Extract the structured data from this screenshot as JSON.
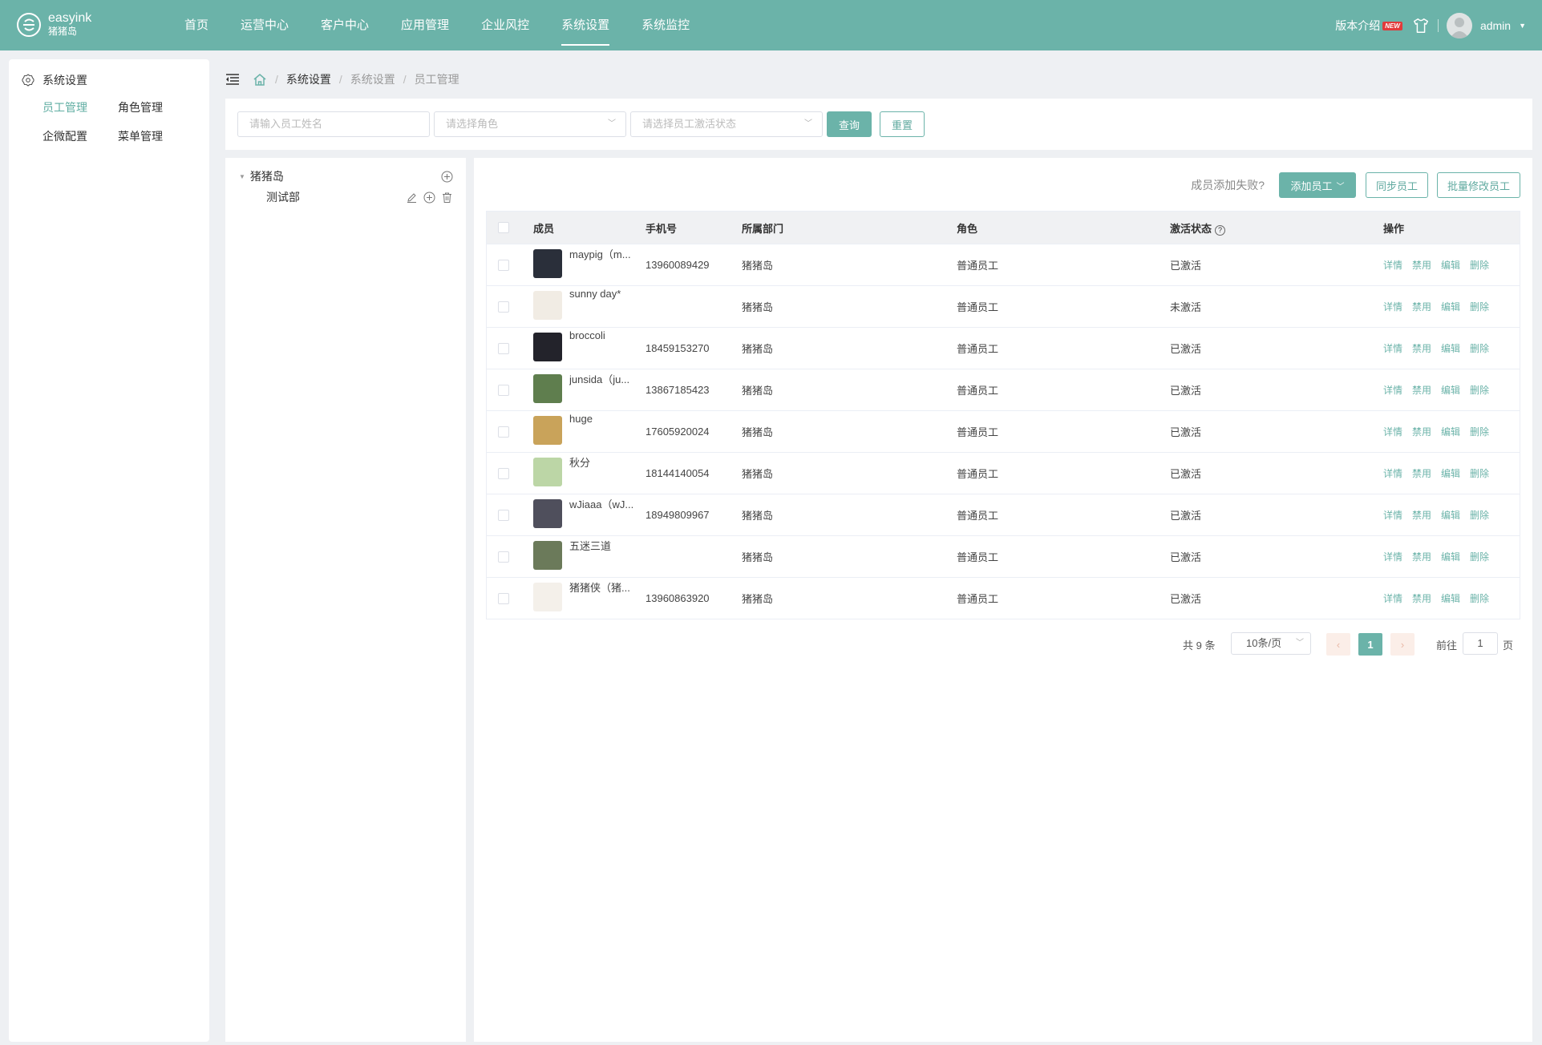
{
  "app": {
    "logo_name": "easyink",
    "logo_sub": "猪猪岛"
  },
  "nav": [
    {
      "label": "首页",
      "active": false
    },
    {
      "label": "运营中心",
      "active": false
    },
    {
      "label": "客户中心",
      "active": false
    },
    {
      "label": "应用管理",
      "active": false
    },
    {
      "label": "企业风控",
      "active": false
    },
    {
      "label": "系统设置",
      "active": true
    },
    {
      "label": "系统监控",
      "active": false
    }
  ],
  "topright": {
    "version_label": "版本介绍",
    "new_badge": "NEW",
    "user": "admin"
  },
  "sidebar": {
    "title": "系统设置",
    "links": [
      {
        "label": "员工管理",
        "active": true
      },
      {
        "label": "角色管理",
        "active": false
      },
      {
        "label": "企微配置",
        "active": false
      },
      {
        "label": "菜单管理",
        "active": false
      }
    ]
  },
  "breadcrumb": [
    "系统设置",
    "系统设置",
    "员工管理"
  ],
  "filters": {
    "name_placeholder": "请输入员工姓名",
    "role_placeholder": "请选择角色",
    "status_placeholder": "请选择员工激活状态",
    "query": "查询",
    "reset": "重置"
  },
  "tree": {
    "root": "猪猪岛",
    "children": [
      "测试部"
    ]
  },
  "toolbar": {
    "fail_text": "成员添加失败?",
    "add": "添加员工",
    "sync": "同步员工",
    "batch": "批量修改员工"
  },
  "table": {
    "headers": [
      "成员",
      "手机号",
      "所属部门",
      "角色",
      "激活状态",
      "操作"
    ],
    "status_help": "?",
    "ops": [
      "详情",
      "禁用",
      "编辑",
      "删除"
    ],
    "rows": [
      {
        "name": "maypig（m...",
        "phone": "13960089429",
        "dept": "猪猪岛",
        "role": "普通员工",
        "status": "已激活"
      },
      {
        "name": "sunny day*",
        "phone": "",
        "dept": "猪猪岛",
        "role": "普通员工",
        "status": "未激活"
      },
      {
        "name": "broccoli",
        "phone": "18459153270",
        "dept": "猪猪岛",
        "role": "普通员工",
        "status": "已激活"
      },
      {
        "name": "junsida（ju...",
        "phone": "13867185423",
        "dept": "猪猪岛",
        "role": "普通员工",
        "status": "已激活"
      },
      {
        "name": "huge",
        "phone": "17605920024",
        "dept": "猪猪岛",
        "role": "普通员工",
        "status": "已激活"
      },
      {
        "name": "秋分",
        "phone": "18144140054",
        "dept": "猪猪岛",
        "role": "普通员工",
        "status": "已激活"
      },
      {
        "name": "wJiaaa（wJ...",
        "phone": "18949809967",
        "dept": "猪猪岛",
        "role": "普通员工",
        "status": "已激活"
      },
      {
        "name": "五迷三道",
        "phone": "",
        "dept": "猪猪岛",
        "role": "普通员工",
        "status": "已激活"
      },
      {
        "name": "猪猪侠（猪...",
        "phone": "13960863920",
        "dept": "猪猪岛",
        "role": "普通员工",
        "status": "已激活"
      }
    ]
  },
  "pagination": {
    "total": "共 9 条",
    "page_size": "10条/页",
    "current": "1",
    "goto": "前往",
    "goto_value": "1",
    "page_unit": "页"
  },
  "colors": {
    "accent": "#6bb3a9",
    "header": "#6bb3a9"
  }
}
